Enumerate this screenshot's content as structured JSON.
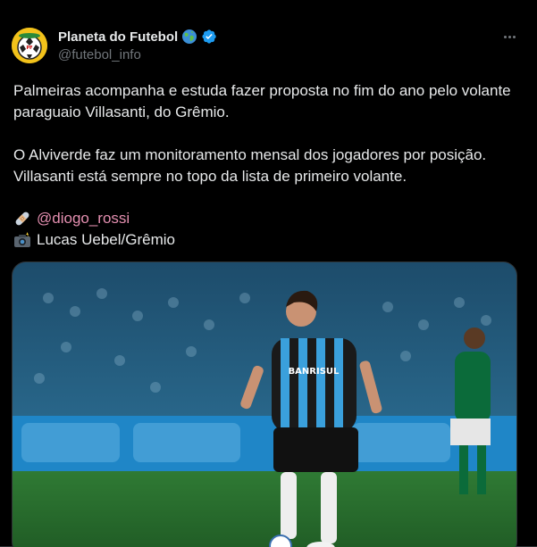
{
  "author": {
    "display_name": "Planeta do Futebol",
    "handle": "@futebol_info",
    "avatar_icon": "planeta-do-futebol-logo",
    "globe_icon": "earth-globe-emoji",
    "verified_icon": "verified-badge-icon",
    "verified_color": "#1d9bf0"
  },
  "menu": {
    "more_icon": "more-horizontal-icon"
  },
  "post": {
    "paragraph_1": "Palmeiras acompanha e estuda fazer proposta no fim do ano pelo volante paraguaio Villasanti, do Grêmio.",
    "paragraph_2": "O Alviverde faz um monitoramento mensal dos jogadores por posição. Villasanti está sempre no topo da lista de primeiro volante.",
    "source_icon": "bandage-emoji",
    "source_mention": "@diogo_rossi",
    "photo_icon": "camera-flash-emoji",
    "photo_credit": "Lucas Uebel/Grêmio"
  },
  "media": {
    "description_icon": "soccer-photo",
    "jersey_text": "BANRISUL"
  },
  "colors": {
    "background": "#000000",
    "text": "#e7e9ea",
    "secondary": "#71767b",
    "mention": "#e48fb0"
  }
}
